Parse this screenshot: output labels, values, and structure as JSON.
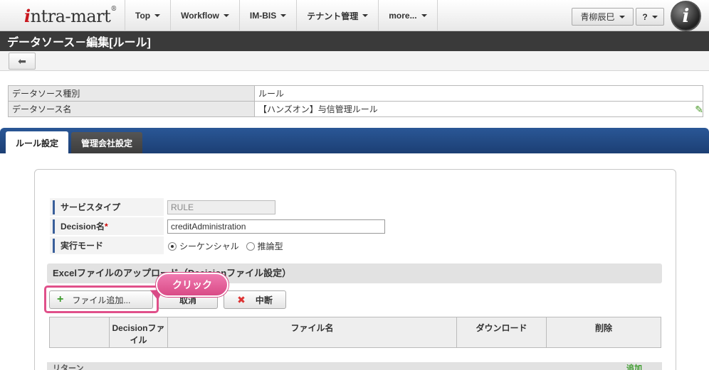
{
  "header": {
    "logo": "intra-mart",
    "menu": [
      "Top",
      "Workflow",
      "IM-BIS",
      "テナント管理",
      "more..."
    ],
    "user": "青柳辰巳",
    "help": "?"
  },
  "title": "データソース－編集[ルール]",
  "info": [
    {
      "key": "データソース種別",
      "value": "ルール"
    },
    {
      "key": "データソース名",
      "value": "【ハンズオン】与信管理ルール"
    }
  ],
  "tabs": {
    "rules": "ルール設定",
    "company": "管理会社設定"
  },
  "form": {
    "service_type_label": "サービスタイプ",
    "service_type_value": "RULE",
    "decision_label": "Decision名",
    "required_mark": "*",
    "decision_value": "creditAdministration",
    "exec_mode_label": "実行モード",
    "mode_sequential": "シーケンシャル",
    "mode_inference": "推論型"
  },
  "upload": {
    "section_title": "Excelファイルのアップロード（Decisionファイル設定）",
    "add_button": "ファイル追加...",
    "cancel_button": "取消",
    "stop_button": "中断",
    "callout": "クリック",
    "columns": [
      "",
      "Decisionファイル",
      "ファイル名",
      "ダウンロード",
      "削除"
    ]
  },
  "bottom": {
    "label": "リターン",
    "add": "追加"
  }
}
